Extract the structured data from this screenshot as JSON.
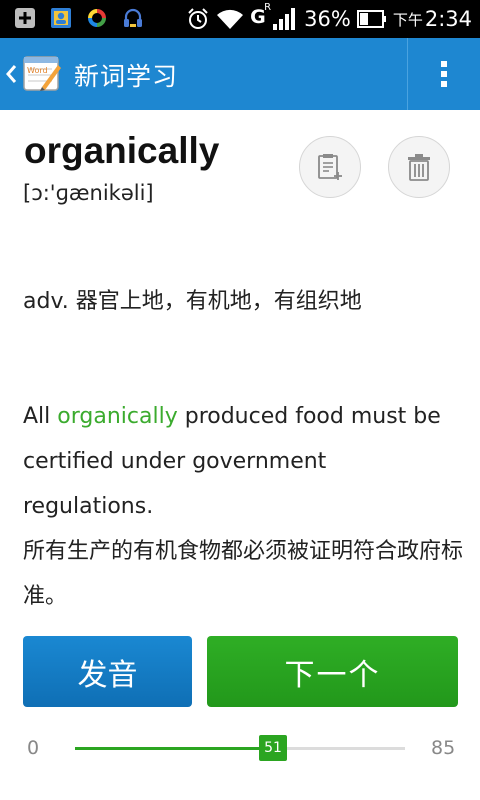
{
  "status_bar": {
    "battery": "36%",
    "network_type": "G",
    "network_roaming": "R",
    "ampm": "下午",
    "time": "2:34",
    "icons": [
      "add-notification-icon",
      "contacts-icon",
      "sync-icon",
      "headset-icon",
      "alarm-icon",
      "wifi-icon",
      "signal-icon",
      "battery-icon"
    ]
  },
  "action_bar": {
    "title": "新词学习",
    "logo_text": "Word"
  },
  "word": {
    "text": "organically",
    "phonetic": "[ɔ:'ɡænikəli]"
  },
  "meaning": "adv. 器官上地，有机地，有组织地",
  "example": {
    "before": "All ",
    "highlight": "organically",
    "after": " produced food must be certified under government regulations.",
    "translation": "所有生产的有机食物都必须被证明符合政府标准。"
  },
  "buttons": {
    "play_label": "发音",
    "next_label": "下一个"
  },
  "progress": {
    "min": "0",
    "max": "85",
    "current": "51",
    "current_value": 51,
    "max_value": 85
  },
  "colors": {
    "action_bar": "#1e87d1",
    "accent_green": "#2ba521",
    "play_button": "#1479c6"
  }
}
